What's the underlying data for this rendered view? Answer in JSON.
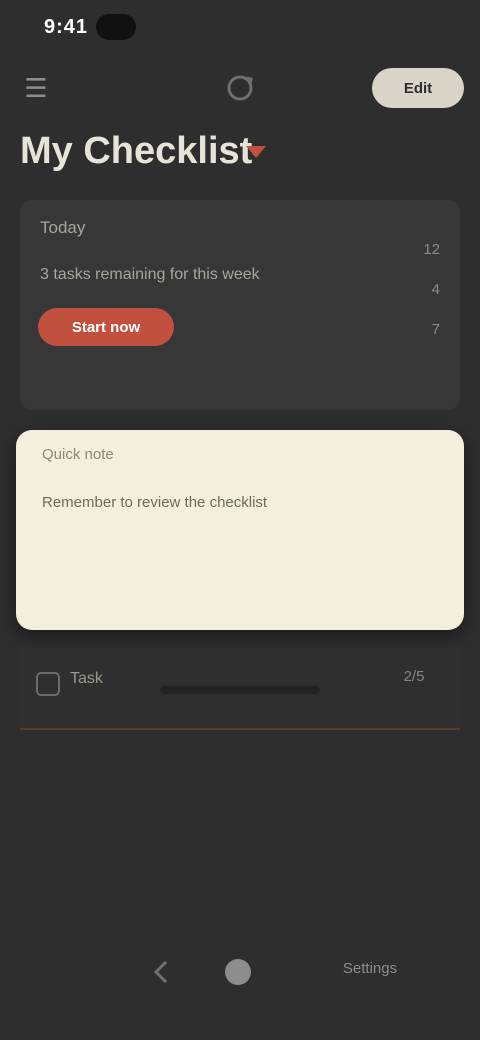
{
  "status_bar": {
    "time": "9:41"
  },
  "top_bar": {
    "menu_icon": "menu-icon",
    "sync_icon": "sync-icon",
    "action_label": "Edit"
  },
  "page": {
    "title": "My Checklist"
  },
  "summary": {
    "label": "Today",
    "description": "3 tasks remaining for this week",
    "button_label": "Start now",
    "stats": [
      "12",
      "4",
      "7"
    ]
  },
  "note": {
    "header": "Quick note",
    "body": "Remember to review the checklist"
  },
  "task": {
    "label": "Task",
    "count": "2/5"
  },
  "bottom_nav": {
    "back_icon": "back-icon",
    "home_icon": "home-icon",
    "label": "Settings"
  },
  "colors": {
    "background": "#2e2e2e",
    "accent": "#c2503f",
    "card": "#373737",
    "note_bg": "#f4eedd"
  }
}
